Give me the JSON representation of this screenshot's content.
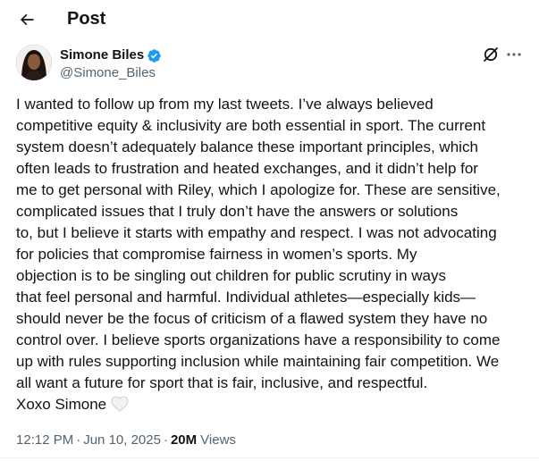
{
  "header": {
    "title": "Post",
    "back_icon": "arrow-left-icon"
  },
  "author": {
    "name": "Simone Biles",
    "handle": "@Simone_Biles",
    "verified": true,
    "verified_color": "#1d9bf0"
  },
  "actions": {
    "grok_icon": "grok-icon",
    "more_icon": "more-horizontal-icon"
  },
  "post": {
    "lines": [
      "I wanted to follow up from my last tweets. I’ve always believed",
      "competitive equity & inclusivity are both essential in sport. The current",
      "system doesn’t adequately balance these important principles, which",
      "often leads to frustration and heated exchanges, and it didn’t help for",
      "me to get personal with Riley, which I apologize for. These are sensitive,",
      "complicated issues that I truly don’t have the answers or solutions",
      "to, but I believe it starts with empathy and respect. I was not advocating",
      "for policies that compromise fairness in women’s sports. My",
      "objection is to be singling out children for public scrutiny in ways",
      "that feel personal and harmful. Individual athletes—especially kids—",
      "should never be the focus of criticism of a flawed system they have no",
      "control over. I believe sports organizations have a responsibility to come",
      "up with rules supporting inclusion while maintaining fair competition. We",
      "all want a future for sport that is fair, inclusive, and respectful.",
      "Xoxo Simone"
    ],
    "emoji": "white-heart-icon"
  },
  "meta": {
    "time": "12:12 PM",
    "separator": "·",
    "date": "Jun 10, 2025",
    "views_count": "20M",
    "views_label": "Views"
  },
  "colors": {
    "text": "#0f1419",
    "secondary": "#536471",
    "accent": "#1d9bf0"
  }
}
